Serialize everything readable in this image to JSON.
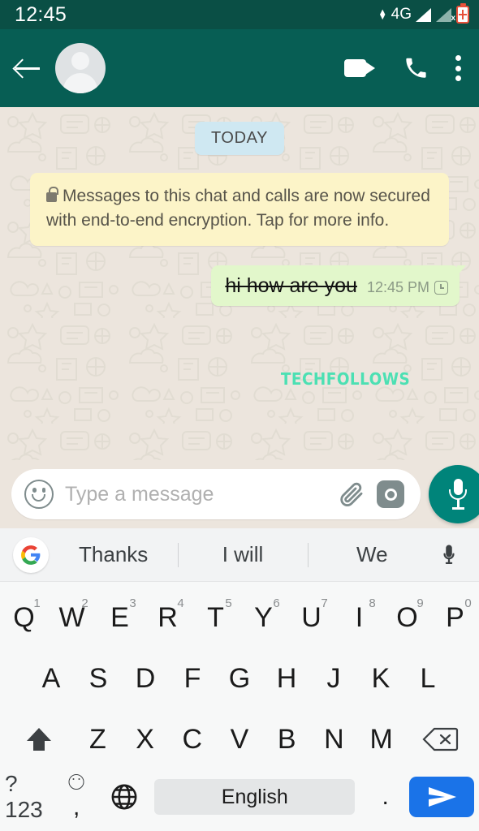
{
  "status_bar": {
    "clock": "12:45",
    "network_type": "4G",
    "data_arrows_icon": "data-transfer-arrows-icon",
    "signal_1_icon": "signal-bars-icon",
    "signal_2_icon": "signal-bars-no-sim-icon",
    "signal_2_badge": "x",
    "battery_icon": "battery-charging-icon"
  },
  "app_bar": {
    "back_icon": "back-arrow-icon",
    "avatar_icon": "default-contact-avatar",
    "contact_name": "",
    "video_call_icon": "video-call-icon",
    "voice_call_icon": "phone-call-icon",
    "overflow_icon": "more-options-icon",
    "background_color": "#075e54"
  },
  "chat": {
    "date_divider": "TODAY",
    "encryption_notice": "Messages to this chat and calls are now secured with end-to-end encryption. Tap for more info.",
    "encryption_lock_icon": "lock-icon",
    "messages": [
      {
        "text": "hi how are you",
        "formatting": "strikethrough",
        "time": "12:45 PM",
        "status_icon": "clock-pending-icon",
        "outgoing": true,
        "bubble_color": "#e2f7cb"
      }
    ],
    "watermark": "TECHFOLLOWS",
    "watermark_color": "#4ce0b3",
    "background_color": "#ece5dd"
  },
  "input_bar": {
    "emoji_icon": "emoji-smiley-icon",
    "placeholder": "Type a message",
    "value": "",
    "attach_icon": "paperclip-attach-icon",
    "camera_icon": "camera-icon",
    "mic_icon": "microphone-icon",
    "mic_button_color": "#00847a"
  },
  "keyboard": {
    "suggestions": {
      "logo_icon": "google-g-logo",
      "items": [
        "Thanks",
        "I will",
        "We"
      ],
      "mic_icon": "voice-input-mic-icon"
    },
    "row1": [
      {
        "letter": "Q",
        "number": "1"
      },
      {
        "letter": "W",
        "number": "2"
      },
      {
        "letter": "E",
        "number": "3"
      },
      {
        "letter": "R",
        "number": "4"
      },
      {
        "letter": "T",
        "number": "5"
      },
      {
        "letter": "Y",
        "number": "6"
      },
      {
        "letter": "U",
        "number": "7"
      },
      {
        "letter": "I",
        "number": "8"
      },
      {
        "letter": "O",
        "number": "9"
      },
      {
        "letter": "P",
        "number": "0"
      }
    ],
    "row2": [
      "A",
      "S",
      "D",
      "F",
      "G",
      "H",
      "J",
      "K",
      "L"
    ],
    "row3": [
      "Z",
      "X",
      "C",
      "V",
      "B",
      "N",
      "M"
    ],
    "shift_icon": "shift-key-icon",
    "backspace_icon": "backspace-key-icon",
    "symbols_label": "?123",
    "comma_label": ",",
    "emoji_key_icon": "emoji-key-icon",
    "language_icon": "globe-language-icon",
    "space_label": "English",
    "period_label": ".",
    "send_icon": "send-paper-plane-icon",
    "send_button_color": "#1a73e8",
    "background_color": "#f7f8f8"
  }
}
